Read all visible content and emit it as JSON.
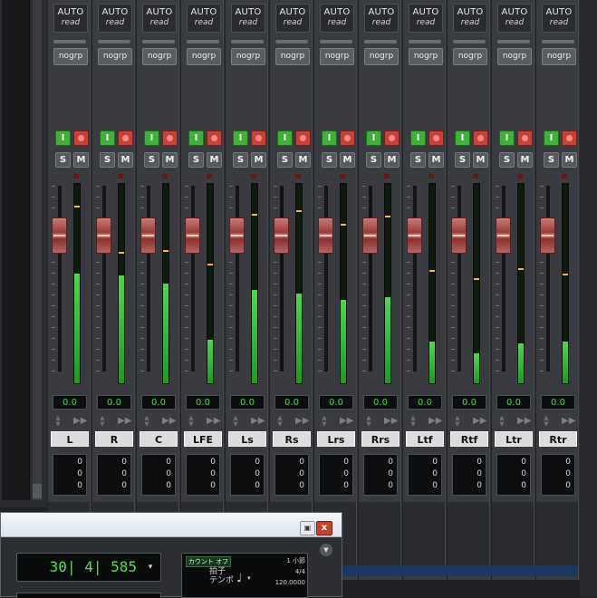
{
  "strips": [
    {
      "name": "L",
      "automation": "AUTO",
      "mode": "read",
      "group": "nogrp",
      "input_btn": "I",
      "solo": "S",
      "mute": "M",
      "volume": "0.0",
      "meter_level": 0.55,
      "peak_level": 0.88,
      "values": [
        "0",
        "0",
        "0"
      ]
    },
    {
      "name": "R",
      "automation": "AUTO",
      "mode": "read",
      "group": "nogrp",
      "input_btn": "I",
      "solo": "S",
      "mute": "M",
      "volume": "0.0",
      "meter_level": 0.54,
      "peak_level": 0.65,
      "values": [
        "0",
        "0",
        "0"
      ]
    },
    {
      "name": "C",
      "automation": "AUTO",
      "mode": "read",
      "group": "nogrp",
      "input_btn": "I",
      "solo": "S",
      "mute": "M",
      "volume": "0.0",
      "meter_level": 0.5,
      "peak_level": 0.66,
      "values": [
        "0",
        "0",
        "0"
      ]
    },
    {
      "name": "LFE",
      "automation": "AUTO",
      "mode": "read",
      "group": "nogrp",
      "input_btn": "I",
      "solo": "S",
      "mute": "M",
      "volume": "0.0",
      "meter_level": 0.22,
      "peak_level": 0.59,
      "values": [
        "0",
        "0",
        "0"
      ]
    },
    {
      "name": "Ls",
      "automation": "AUTO",
      "mode": "read",
      "group": "nogrp",
      "input_btn": "I",
      "solo": "S",
      "mute": "M",
      "volume": "0.0",
      "meter_level": 0.47,
      "peak_level": 0.84,
      "values": [
        "0",
        "0",
        "0"
      ]
    },
    {
      "name": "Rs",
      "automation": "AUTO",
      "mode": "read",
      "group": "nogrp",
      "input_btn": "I",
      "solo": "S",
      "mute": "M",
      "volume": "0.0",
      "meter_level": 0.45,
      "peak_level": 0.86,
      "values": [
        "0",
        "0",
        "0"
      ]
    },
    {
      "name": "Lrs",
      "automation": "AUTO",
      "mode": "read",
      "group": "nogrp",
      "input_btn": "I",
      "solo": "S",
      "mute": "M",
      "volume": "0.0",
      "meter_level": 0.42,
      "peak_level": 0.79,
      "values": [
        "0",
        "0",
        "0"
      ]
    },
    {
      "name": "Rrs",
      "automation": "AUTO",
      "mode": "read",
      "group": "nogrp",
      "input_btn": "I",
      "solo": "S",
      "mute": "M",
      "volume": "0.0",
      "meter_level": 0.43,
      "peak_level": 0.83,
      "values": [
        "0",
        "0",
        "0"
      ]
    },
    {
      "name": "Ltf",
      "automation": "AUTO",
      "mode": "read",
      "group": "nogrp",
      "input_btn": "I",
      "solo": "S",
      "mute": "M",
      "volume": "0.0",
      "meter_level": 0.21,
      "peak_level": 0.56,
      "values": [
        "0",
        "0",
        "0"
      ]
    },
    {
      "name": "Rtf",
      "automation": "AUTO",
      "mode": "read",
      "group": "nogrp",
      "input_btn": "I",
      "solo": "S",
      "mute": "M",
      "volume": "0.0",
      "meter_level": 0.15,
      "peak_level": 0.52,
      "values": [
        "0",
        "0",
        "0"
      ]
    },
    {
      "name": "Ltr",
      "automation": "AUTO",
      "mode": "read",
      "group": "nogrp",
      "input_btn": "I",
      "solo": "S",
      "mute": "M",
      "volume": "0.0",
      "meter_level": 0.2,
      "peak_level": 0.57,
      "values": [
        "0",
        "0",
        "0"
      ]
    },
    {
      "name": "Rtr",
      "automation": "AUTO",
      "mode": "read",
      "group": "nogrp",
      "input_btn": "I",
      "solo": "S",
      "mute": "M",
      "volume": "0.0",
      "meter_level": 0.21,
      "peak_level": 0.54,
      "values": [
        "0",
        "0",
        "0"
      ]
    }
  ],
  "transport": {
    "restore_icon": "▣",
    "close_icon": "x",
    "counter": "30| 4| 585",
    "count_off": "カウント オフ",
    "bars": "1 小節",
    "meter_label": "拍子",
    "meter_value": "4/4",
    "tempo_label": "テンポ",
    "tempo_value": "120.0000",
    "note_glyph": "♩",
    "dropdown_glyph": "▾"
  },
  "colors": {
    "meter_green": "#2ec02a",
    "peak": "#ffb347",
    "record": "#c5423a",
    "input": "#3fb03a"
  }
}
